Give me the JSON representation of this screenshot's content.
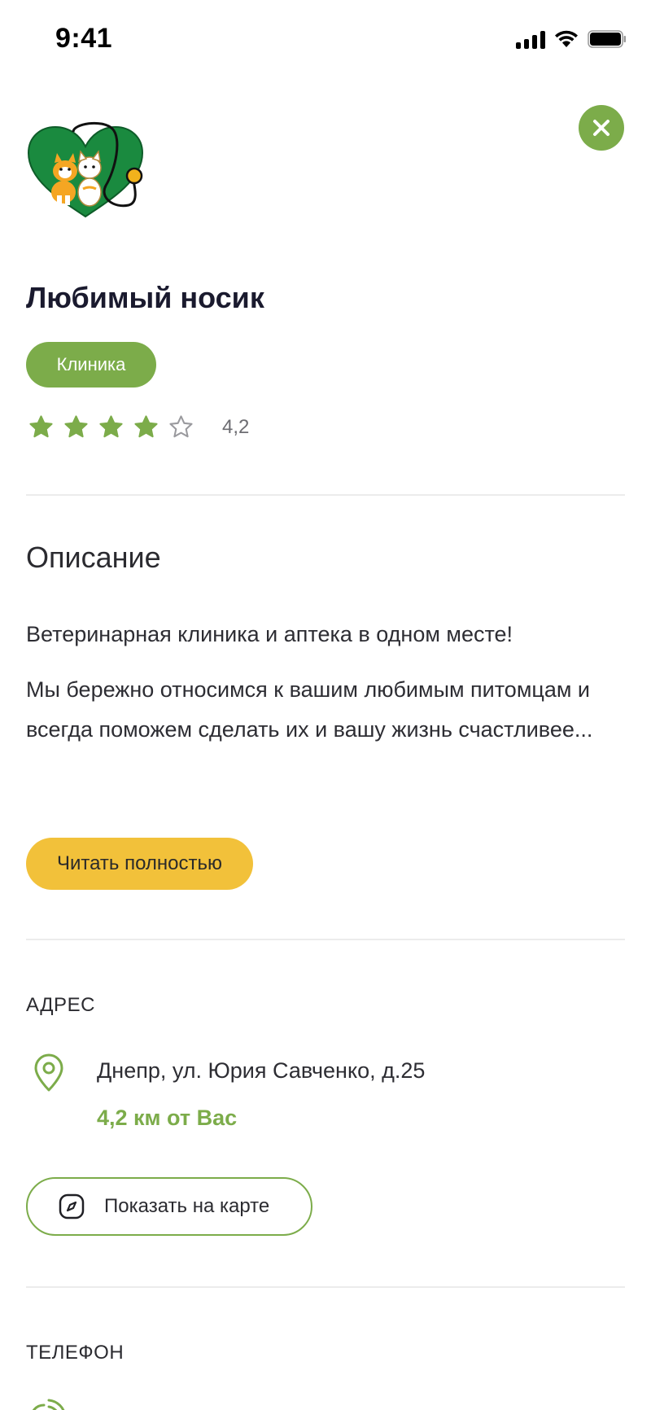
{
  "status_bar": {
    "time": "9:41"
  },
  "clinic": {
    "name": "Любимый носик",
    "category": "Клиника",
    "rating": 4.2,
    "rating_label": "4,2",
    "stars_filled": 4,
    "stars_total": 5
  },
  "description": {
    "title": "Описание",
    "paragraph1": "Ветеринарная клиника и аптека в одном месте!",
    "paragraph2": "Мы бережно относимся к вашим любимым питомцам и всегда поможем сделать их и вашу жизнь счастливее...",
    "read_more_label": "Читать полностью"
  },
  "address": {
    "label": "АДРЕС",
    "value": "Днепр, ул. Юрия Савченко, д.25",
    "distance": "4,2 км от Вас",
    "show_on_map_label": "Показать на карте"
  },
  "phone": {
    "label": "ТЕЛЕФОН"
  },
  "colors": {
    "accent_green": "#7cac4a",
    "button_yellow": "#f2c13a",
    "logo_green": "#1a8a3f",
    "divider": "#ececec"
  },
  "icons": [
    "signal-icon",
    "wifi-icon",
    "battery-icon",
    "close-icon",
    "star-icon",
    "star-outline-icon",
    "location-pin-icon",
    "compass-icon",
    "phone-icon"
  ]
}
